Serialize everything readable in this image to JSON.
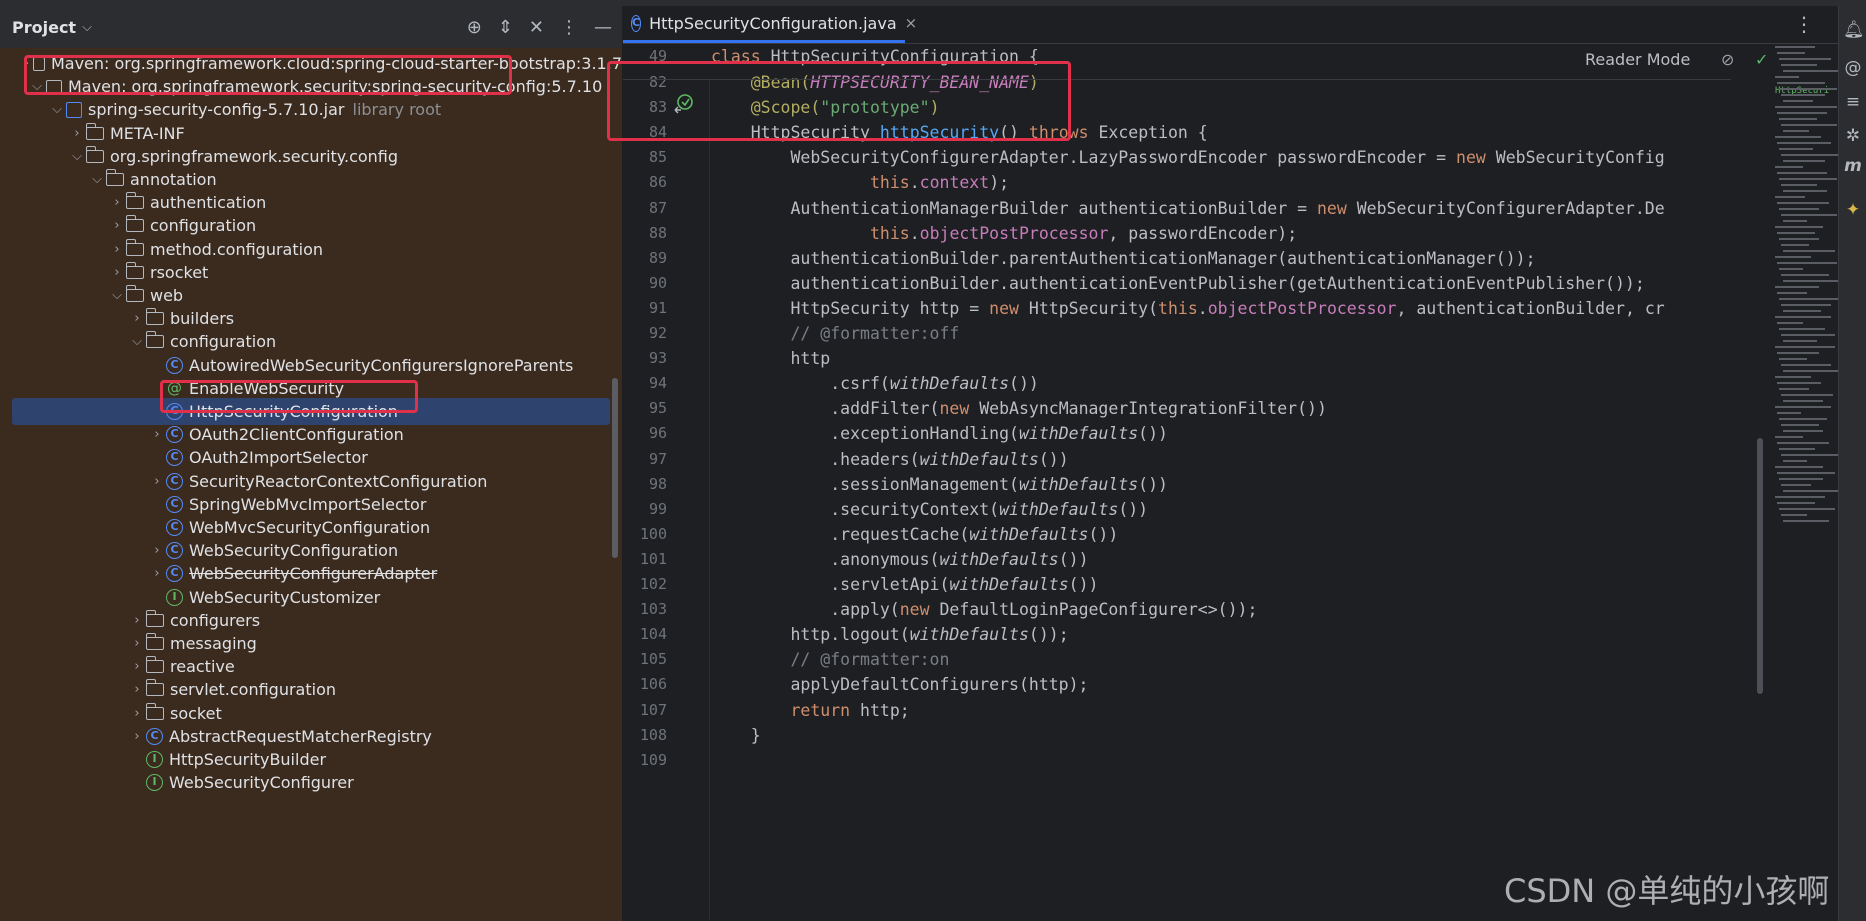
{
  "project_panel": {
    "title": "Project",
    "actions": [
      "target-icon",
      "expand-icon",
      "collapse-icon",
      "more-icon",
      "hide-icon"
    ],
    "tree": [
      {
        "label": "Maven: org.springframework.cloud:spring-cloud-starter-bootstrap:3.1.7",
        "icon": "library",
        "arrow": "collapsed",
        "depth": 0
      },
      {
        "label": "Maven: org.springframework.security:spring-security-config:5.7.10",
        "icon": "library",
        "arrow": "expanded",
        "depth": 0
      },
      {
        "label": "spring-security-config-5.7.10.jar",
        "suffix": "library root",
        "icon": "jar",
        "arrow": "expanded",
        "depth": 1
      },
      {
        "label": "META-INF",
        "icon": "folder",
        "arrow": "collapsed",
        "depth": 2
      },
      {
        "label": "org.springframework.security.config",
        "icon": "folder",
        "arrow": "expanded",
        "depth": 2
      },
      {
        "label": "annotation",
        "icon": "folder",
        "arrow": "expanded",
        "depth": 3
      },
      {
        "label": "authentication",
        "icon": "folder",
        "arrow": "collapsed",
        "depth": 4
      },
      {
        "label": "configuration",
        "icon": "folder",
        "arrow": "collapsed",
        "depth": 4
      },
      {
        "label": "method.configuration",
        "icon": "folder",
        "arrow": "collapsed",
        "depth": 4
      },
      {
        "label": "rsocket",
        "icon": "folder",
        "arrow": "collapsed",
        "depth": 4
      },
      {
        "label": "web",
        "icon": "folder",
        "arrow": "expanded",
        "depth": 4
      },
      {
        "label": "builders",
        "icon": "folder",
        "arrow": "collapsed",
        "depth": 5
      },
      {
        "label": "configuration",
        "icon": "folder",
        "arrow": "expanded",
        "depth": 5
      },
      {
        "label": "AutowiredWebSecurityConfigurersIgnoreParents",
        "icon": "class",
        "arrow": "none",
        "depth": 6
      },
      {
        "label": "EnableWebSecurity",
        "icon": "annotation",
        "arrow": "none",
        "depth": 6
      },
      {
        "label": "HttpSecurityConfiguration",
        "icon": "class",
        "arrow": "none",
        "depth": 6,
        "selected": true
      },
      {
        "label": "OAuth2ClientConfiguration",
        "icon": "class",
        "arrow": "collapsed",
        "depth": 6
      },
      {
        "label": "OAuth2ImportSelector",
        "icon": "class",
        "arrow": "none",
        "depth": 6
      },
      {
        "label": "SecurityReactorContextConfiguration",
        "icon": "class",
        "arrow": "collapsed",
        "depth": 6
      },
      {
        "label": "SpringWebMvcImportSelector",
        "icon": "class",
        "arrow": "none",
        "depth": 6
      },
      {
        "label": "WebMvcSecurityConfiguration",
        "icon": "class",
        "arrow": "none",
        "depth": 6
      },
      {
        "label": "WebSecurityConfiguration",
        "icon": "class",
        "arrow": "collapsed",
        "depth": 6
      },
      {
        "label": "WebSecurityConfigurerAdapter",
        "icon": "class",
        "arrow": "collapsed",
        "depth": 6,
        "deprecated": true
      },
      {
        "label": "WebSecurityCustomizer",
        "icon": "interface",
        "arrow": "none",
        "depth": 6
      },
      {
        "label": "configurers",
        "icon": "folder",
        "arrow": "collapsed",
        "depth": 5
      },
      {
        "label": "messaging",
        "icon": "folder",
        "arrow": "collapsed",
        "depth": 5
      },
      {
        "label": "reactive",
        "icon": "folder",
        "arrow": "collapsed",
        "depth": 5
      },
      {
        "label": "servlet.configuration",
        "icon": "folder",
        "arrow": "collapsed",
        "depth": 5
      },
      {
        "label": "socket",
        "icon": "folder",
        "arrow": "collapsed",
        "depth": 5
      },
      {
        "label": "AbstractRequestMatcherRegistry",
        "icon": "class",
        "arrow": "collapsed",
        "depth": 5
      },
      {
        "label": "HttpSecurityBuilder",
        "icon": "interface",
        "arrow": "none",
        "depth": 5
      },
      {
        "label": "WebSecurityConfigurer",
        "icon": "interface",
        "arrow": "none",
        "depth": 5
      }
    ]
  },
  "editor": {
    "tab": {
      "label": "HttpSecurityConfiguration.java",
      "close": "×"
    },
    "reader_mode": "Reader Mode",
    "sticky_line": {
      "number": "49",
      "segments": [
        {
          "t": "class ",
          "c": "kw"
        },
        {
          "t": "HttpSecurityConfiguration {",
          "c": ""
        }
      ]
    },
    "lines": [
      {
        "n": "82",
        "segments": [
          {
            "t": "    @Bean(",
            "c": "an"
          },
          {
            "t": "HTTPSECURITY_BEAN_NAME",
            "c": "fld it"
          },
          {
            "t": ")",
            "c": "an"
          }
        ]
      },
      {
        "n": "83",
        "segments": [
          {
            "t": "    @Scope(",
            "c": "an"
          },
          {
            "t": "\"prototype\"",
            "c": "str"
          },
          {
            "t": ")",
            "c": "an"
          }
        ]
      },
      {
        "n": "84",
        "segments": [
          {
            "t": "    HttpSecurity ",
            "c": ""
          },
          {
            "t": "httpSecurity",
            "c": "fn"
          },
          {
            "t": "() ",
            "c": ""
          },
          {
            "t": "throws",
            "c": "kw"
          },
          {
            "t": " Exception {",
            "c": ""
          }
        ]
      },
      {
        "n": "85",
        "segments": [
          {
            "t": "        WebSecurityConfigurerAdapter.LazyPasswordEncoder passwordEncoder = ",
            "c": ""
          },
          {
            "t": "new",
            "c": "kw"
          },
          {
            "t": " WebSecurityConfig",
            "c": ""
          }
        ]
      },
      {
        "n": "86",
        "segments": [
          {
            "t": "                ",
            "c": ""
          },
          {
            "t": "this",
            "c": "kw"
          },
          {
            "t": ".",
            "c": ""
          },
          {
            "t": "context",
            "c": "fld"
          },
          {
            "t": ");",
            "c": ""
          }
        ]
      },
      {
        "n": "87",
        "segments": [
          {
            "t": "        AuthenticationManagerBuilder authenticationBuilder = ",
            "c": ""
          },
          {
            "t": "new",
            "c": "kw"
          },
          {
            "t": " WebSecurityConfigurerAdapter.De",
            "c": ""
          }
        ]
      },
      {
        "n": "88",
        "segments": [
          {
            "t": "                ",
            "c": ""
          },
          {
            "t": "this",
            "c": "kw"
          },
          {
            "t": ".",
            "c": ""
          },
          {
            "t": "objectPostProcessor",
            "c": "fld"
          },
          {
            "t": ", passwordEncoder);",
            "c": ""
          }
        ]
      },
      {
        "n": "89",
        "segments": [
          {
            "t": "        authenticationBuilder.parentAuthenticationManager(authenticationManager());",
            "c": ""
          }
        ]
      },
      {
        "n": "90",
        "segments": [
          {
            "t": "        authenticationBuilder.authenticationEventPublisher(getAuthenticationEventPublisher());",
            "c": ""
          }
        ]
      },
      {
        "n": "91",
        "segments": [
          {
            "t": "        HttpSecurity http = ",
            "c": ""
          },
          {
            "t": "new",
            "c": "kw"
          },
          {
            "t": " HttpSecurity(",
            "c": ""
          },
          {
            "t": "this",
            "c": "kw"
          },
          {
            "t": ".",
            "c": ""
          },
          {
            "t": "objectPostProcessor",
            "c": "fld"
          },
          {
            "t": ", authenticationBuilder, cr",
            "c": ""
          }
        ]
      },
      {
        "n": "92",
        "segments": [
          {
            "t": "        // @formatter:off",
            "c": "cm"
          }
        ]
      },
      {
        "n": "93",
        "segments": [
          {
            "t": "        http",
            "c": ""
          }
        ]
      },
      {
        "n": "94",
        "segments": [
          {
            "t": "            .csrf(",
            "c": ""
          },
          {
            "t": "withDefaults",
            "c": "it"
          },
          {
            "t": "())",
            "c": ""
          }
        ]
      },
      {
        "n": "95",
        "segments": [
          {
            "t": "            .addFilter(",
            "c": ""
          },
          {
            "t": "new",
            "c": "kw"
          },
          {
            "t": " WebAsyncManagerIntegrationFilter())",
            "c": ""
          }
        ]
      },
      {
        "n": "96",
        "segments": [
          {
            "t": "            .exceptionHandling(",
            "c": ""
          },
          {
            "t": "withDefaults",
            "c": "it"
          },
          {
            "t": "())",
            "c": ""
          }
        ]
      },
      {
        "n": "97",
        "segments": [
          {
            "t": "            .headers(",
            "c": ""
          },
          {
            "t": "withDefaults",
            "c": "it"
          },
          {
            "t": "())",
            "c": ""
          }
        ]
      },
      {
        "n": "98",
        "segments": [
          {
            "t": "            .sessionManagement(",
            "c": ""
          },
          {
            "t": "withDefaults",
            "c": "it"
          },
          {
            "t": "())",
            "c": ""
          }
        ]
      },
      {
        "n": "99",
        "segments": [
          {
            "t": "            .securityContext(",
            "c": ""
          },
          {
            "t": "withDefaults",
            "c": "it"
          },
          {
            "t": "())",
            "c": ""
          }
        ]
      },
      {
        "n": "100",
        "segments": [
          {
            "t": "            .requestCache(",
            "c": ""
          },
          {
            "t": "withDefaults",
            "c": "it"
          },
          {
            "t": "())",
            "c": ""
          }
        ]
      },
      {
        "n": "101",
        "segments": [
          {
            "t": "            .anonymous(",
            "c": ""
          },
          {
            "t": "withDefaults",
            "c": "it"
          },
          {
            "t": "())",
            "c": ""
          }
        ]
      },
      {
        "n": "102",
        "segments": [
          {
            "t": "            .servletApi(",
            "c": ""
          },
          {
            "t": "withDefaults",
            "c": "it"
          },
          {
            "t": "())",
            "c": ""
          }
        ]
      },
      {
        "n": "103",
        "segments": [
          {
            "t": "            .apply(",
            "c": ""
          },
          {
            "t": "new",
            "c": "kw"
          },
          {
            "t": " DefaultLoginPageConfigurer<>());",
            "c": ""
          }
        ]
      },
      {
        "n": "104",
        "segments": [
          {
            "t": "        http.logout(",
            "c": ""
          },
          {
            "t": "withDefaults",
            "c": "it"
          },
          {
            "t": "());",
            "c": ""
          }
        ]
      },
      {
        "n": "105",
        "segments": [
          {
            "t": "        // @formatter:on",
            "c": "cm"
          }
        ]
      },
      {
        "n": "106",
        "segments": [
          {
            "t": "        applyDefaultConfigurers(http);",
            "c": ""
          }
        ]
      },
      {
        "n": "107",
        "segments": [
          {
            "t": "        ",
            "c": ""
          },
          {
            "t": "return",
            "c": "kw"
          },
          {
            "t": " http;",
            "c": ""
          }
        ]
      },
      {
        "n": "108",
        "segments": [
          {
            "t": "    }",
            "c": ""
          }
        ]
      },
      {
        "n": "109",
        "segments": []
      }
    ]
  },
  "minimap": {
    "label": "HttpSecuri"
  },
  "right_strip": {
    "icons": [
      "notifications-icon",
      "ai-assistant-icon",
      "database-icon",
      "maven-icon",
      "m-icon",
      "plugin-icon"
    ]
  },
  "watermark": "CSDN @单纯的小孩啊",
  "colors": {
    "highlight": "#e0304a",
    "selection": "#2e436e",
    "project_bg": "#3b2b1f",
    "editor_bg": "#1e1f22"
  }
}
